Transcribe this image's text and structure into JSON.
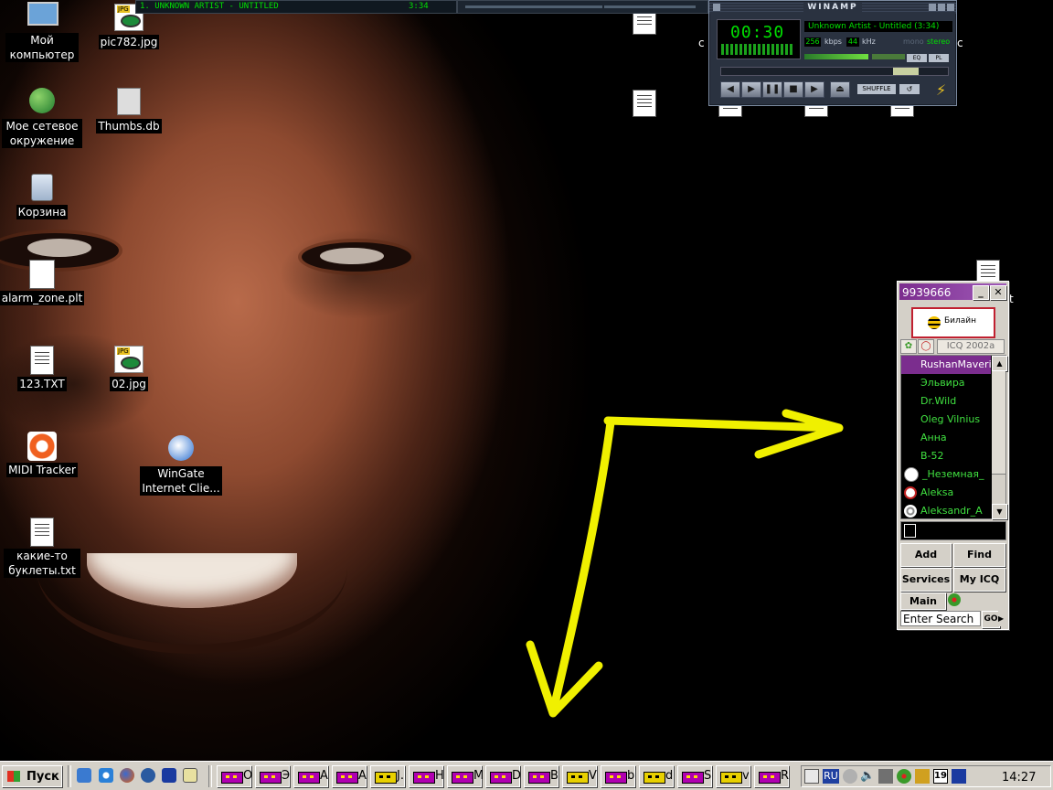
{
  "desktop": {
    "icons": [
      {
        "label": "Мой компьютер",
        "icon": "my-computer-icon"
      },
      {
        "label": "pic782.jpg",
        "icon": "jpg-image-icon"
      },
      {
        "label": "Мое сетевое окружение",
        "icon": "network-places-icon"
      },
      {
        "label": "Thumbs.db",
        "icon": "thumbs-db-icon"
      },
      {
        "label": "Корзина",
        "icon": "recycle-bin-icon"
      },
      {
        "label": "alarm_zone.plt",
        "icon": "plt-file-icon"
      },
      {
        "label": "123.TXT",
        "icon": "text-file-icon"
      },
      {
        "label": "02.jpg",
        "icon": "jpg-image-icon"
      },
      {
        "label": "MIDI Tracker",
        "icon": "midi-tracker-icon"
      },
      {
        "label": "WinGate Internet Clie...",
        "icon": "wingate-icon"
      },
      {
        "label": "какие-то буклеты.txt",
        "icon": "text-file-icon"
      }
    ],
    "stray_chars": {
      "left": "c",
      "right": "c",
      "icq_side": "t"
    }
  },
  "winamp": {
    "title": "WINAMP",
    "time": "00:30",
    "song": "Unknown Artist - Untitled (3:34)",
    "kbps": "256",
    "kbps_label": "kbps",
    "khz": "44",
    "khz_label": "kHz",
    "mono": "mono",
    "stereo": "stereo",
    "eq_label": "EQ",
    "pl_label": "PL",
    "shuffle_label": "SHUFFLE",
    "controls": [
      "prev-icon",
      "play-icon",
      "pause-icon",
      "stop-icon",
      "next-icon",
      "eject-icon"
    ],
    "playlist_title": "1. UNKNOWN ARTIST - UNTITLED",
    "playlist_time": "3:34"
  },
  "icq": {
    "uin": "9939666",
    "banner": "Билайн",
    "version": "ICQ 2002a",
    "contacts": [
      {
        "name": "RushanMaveric",
        "status": "online"
      },
      {
        "name": "Эльвира",
        "status": "online"
      },
      {
        "name": "Dr.Wild",
        "status": "online"
      },
      {
        "name": "Oleg Vilnius",
        "status": "online"
      },
      {
        "name": "Анна",
        "status": "online"
      },
      {
        "name": "B-52",
        "status": "online"
      },
      {
        "name": "_Неземная_",
        "status": "away"
      },
      {
        "name": "Aleksa",
        "status": "na"
      },
      {
        "name": "Aleksandr_A",
        "status": "offline"
      }
    ],
    "buttons": {
      "add": "Add",
      "find": "Find",
      "services": "Services",
      "myicq": "My ICQ",
      "main": "Main"
    },
    "search_value": "Enter Search",
    "go": "GO"
  },
  "taskbar": {
    "start": "Пуск",
    "quick_launch": [
      "show-desktop-icon",
      "internet-explorer-icon",
      "firefox-icon",
      "netscape-icon",
      "save-icon",
      "notepad-icon"
    ],
    "tasks": [
      "O",
      "Э",
      "A",
      "A",
      "J.",
      "H",
      "M",
      "D",
      "B",
      "V",
      "b",
      "d",
      "S",
      "v",
      "R"
    ],
    "lang": "RU",
    "clock": "14:27"
  },
  "colors": {
    "arrow": "#f0f000",
    "icq_accent": "#7b2d8e",
    "winamp_green": "#00e000"
  }
}
